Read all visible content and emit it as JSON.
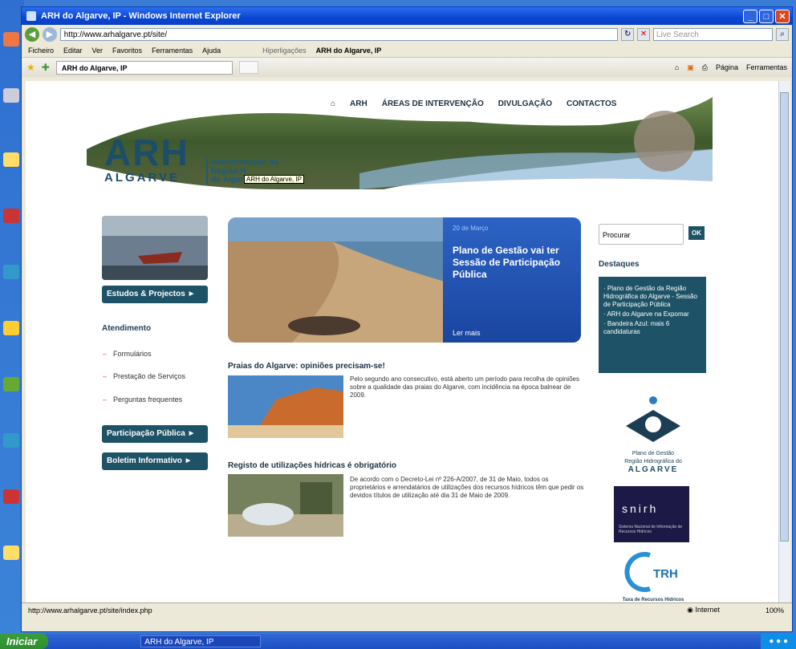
{
  "window": {
    "title": "ARH do Algarve, IP - Windows Internet Explorer",
    "address": "http://www.arhalgarve.pt/site/",
    "search_placeholder": "Live Search",
    "menu": [
      "Ficheiro",
      "Editar",
      "Ver",
      "Favoritos",
      "Ferramentas",
      "Ajuda"
    ],
    "links_label": "Hiperligações",
    "links_item": "ARH do Algarve, IP",
    "tab_label": "ARH do Algarve, IP",
    "tools": [
      "Página",
      "Ferramentas"
    ],
    "status_url": "http://www.arhalgarve.pt/site/index.php",
    "status_zone": "Internet",
    "status_zoom": "100%"
  },
  "taskbar": {
    "start": "Iniciar",
    "task": "ARH do Algarve, IP"
  },
  "site": {
    "nav": [
      "ARH",
      "ÁREAS DE INTERVENÇÃO",
      "DIVULGAÇÃO",
      "CONTACTOS"
    ],
    "logo": {
      "arh": "ARH",
      "algarve": "ALGARVE",
      "subtitle_1": "Administração da",
      "subtitle_2": "Região H",
      "subtitle_3": "do Algarve"
    },
    "tooltip": "ARH do Algarve, IP",
    "left": {
      "estudos": "Estudos & Projectos ►",
      "atendimento_title": "Atendimento",
      "atendimento_items": [
        "Formulários",
        "Prestação de Serviços",
        "Perguntas frequentes"
      ],
      "participacao": "Participação Pública ►",
      "boletim": "Boletim Informativo ►"
    },
    "feature": {
      "date": "20 de Março",
      "title": "Plano de Gestão vai ter Sessão de Participação Pública",
      "more": "Ler mais"
    },
    "articles": [
      {
        "title": "Praias do Algarve: opiniões precisam-se!",
        "text": "Pelo segundo ano consecutivo, está aberto um período para recolha de opiniões sobre a qualidade das praias do Algarve, com incidência na época balnear de 2009."
      },
      {
        "title": "Registo de utilizações hídricas é obrigatório",
        "text": "De acordo com o Decreto-Lei nº 226-A/2007, de 31 de Maio, todos os proprietários e arrendatários de utilizações dos recursos hídricos têm que pedir os devidos títulos de utilização até dia 31 de Maio de 2009."
      }
    ],
    "right": {
      "search_label": "Procurar",
      "ok": "OK",
      "destaques_title": "Destaques",
      "destaques": [
        "· Plano de Gestão da Região Hidrográfica do Algarve - Sessão de Participação Pública",
        "· ARH do Algarve na Expomar",
        "· Bandeira Azul: mais 6 candidaturas"
      ],
      "plano_text_1": "Plano de Gestão",
      "plano_text_2": "Região Hidrográfica do",
      "plano_alg": "ALGARVE",
      "snirh": "snirh",
      "snirh_sub": "Sistema Nacional de Informação de Recursos Hídricos",
      "trh": "TRH",
      "trh_caption": "Taxa de Recursos Hídricos"
    }
  }
}
